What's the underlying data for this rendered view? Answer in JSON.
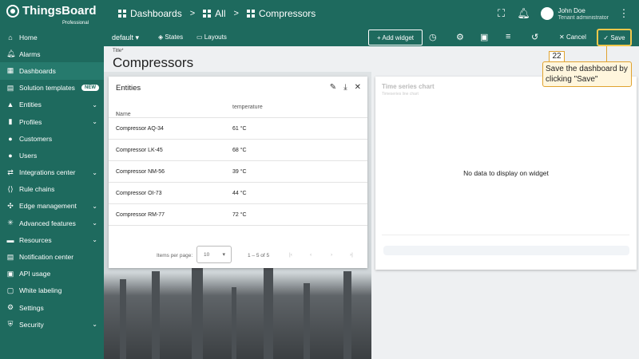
{
  "app": {
    "name": "ThingsBoard",
    "edition": "Professional"
  },
  "breadcrumb": {
    "first": "Dashboards",
    "sep1": ">",
    "second": "All",
    "sep2": ">",
    "third": "Compressors"
  },
  "user": {
    "name": "John Doe",
    "role": "Tenant administrator"
  },
  "sidebar": {
    "items": [
      {
        "label": "Home",
        "icon": "home-icon"
      },
      {
        "label": "Alarms",
        "icon": "bell-icon"
      },
      {
        "label": "Dashboards",
        "icon": "dashboard-icon",
        "active": true
      },
      {
        "label": "Solution templates",
        "icon": "template-icon",
        "badge": "NEW"
      },
      {
        "label": "Entities",
        "icon": "entities-icon",
        "expandable": true
      },
      {
        "label": "Profiles",
        "icon": "profiles-icon",
        "expandable": true
      },
      {
        "label": "Customers",
        "icon": "customers-icon"
      },
      {
        "label": "Users",
        "icon": "users-icon"
      },
      {
        "label": "Integrations center",
        "icon": "integrations-icon",
        "expandable": true
      },
      {
        "label": "Rule chains",
        "icon": "rule-chains-icon"
      },
      {
        "label": "Edge management",
        "icon": "edge-icon",
        "expandable": true
      },
      {
        "label": "Advanced features",
        "icon": "advanced-icon",
        "expandable": true
      },
      {
        "label": "Resources",
        "icon": "folder-icon",
        "expandable": true
      },
      {
        "label": "Notification center",
        "icon": "notification-icon"
      },
      {
        "label": "API usage",
        "icon": "api-icon"
      },
      {
        "label": "White labeling",
        "icon": "white-label-icon"
      },
      {
        "label": "Settings",
        "icon": "gear-icon"
      },
      {
        "label": "Security",
        "icon": "shield-icon",
        "expandable": true
      }
    ]
  },
  "toolbar": {
    "state": "default",
    "states_label": "States",
    "layouts_label": "Layouts",
    "add_widget_label": "+ Add widget",
    "cancel_label": "Cancel",
    "save_label": "Save"
  },
  "dashboard": {
    "title_label": "Title*",
    "title": "Compressors"
  },
  "entities_widget": {
    "title": "Entities",
    "columns": [
      "Name",
      "temperature"
    ],
    "rows": [
      {
        "name": "Compressor AQ-34",
        "temperature": "61 °C"
      },
      {
        "name": "Compressor LK-45",
        "temperature": "68 °C"
      },
      {
        "name": "Compressor NM-56",
        "temperature": "39 °C"
      },
      {
        "name": "Compressor OI-73",
        "temperature": "44 °C"
      },
      {
        "name": "Compressor RM-77",
        "temperature": "72 °C"
      }
    ],
    "items_per_page_label": "Items per page:",
    "items_per_page": "10",
    "range": "1 – 5 of 5"
  },
  "timeseries_widget": {
    "title": "Time series chart",
    "subtitle": "Timeseries line chart",
    "empty_text": "No data to display on widget"
  },
  "callout": {
    "step": "22",
    "text": "Save the dashboard by clicking \"Save\""
  },
  "colors": {
    "primary": "#1e6a5e",
    "highlight": "#f2c84b",
    "callout_bg": "#fff6dd"
  }
}
